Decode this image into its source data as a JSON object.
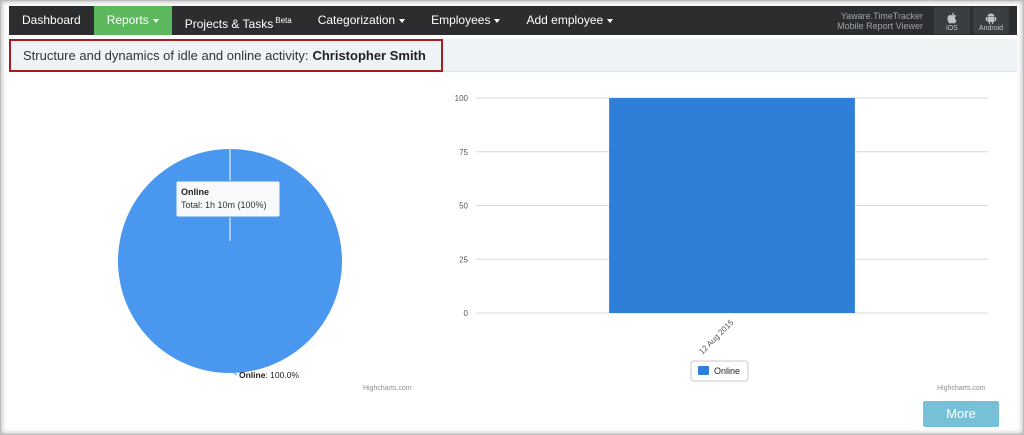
{
  "nav": {
    "items": [
      {
        "label": "Dashboard",
        "active": false,
        "dropdown": false
      },
      {
        "label": "Reports",
        "active": true,
        "dropdown": true
      },
      {
        "label": "Projects & Tasks",
        "badge": "Beta",
        "active": false,
        "dropdown": false
      },
      {
        "label": "Categorization",
        "active": false,
        "dropdown": true
      },
      {
        "label": "Employees",
        "active": false,
        "dropdown": true
      },
      {
        "label": "Add employee",
        "active": false,
        "dropdown": true
      }
    ],
    "mobile_line1": "Yaware.TimeTracker",
    "mobile_line2": "Mobile Report Viewer",
    "ios_label": "iOS",
    "android_label": "Android"
  },
  "header": {
    "title_prefix": "Structure and dynamics of idle and online activity:",
    "user_name": "Christopher Smith"
  },
  "pie": {
    "tooltip_title": "Online",
    "tooltip_text": "Total: 1h 10m (100%)",
    "label_name": "Online",
    "label_value": ": 100.0%",
    "credit": "Highcharts.com",
    "color": "#4a97ef"
  },
  "chart_data": [
    {
      "type": "pie",
      "slices": [
        {
          "name": "Online",
          "value": 100.0
        }
      ]
    },
    {
      "type": "bar",
      "categories": [
        "12 Aug 2015"
      ],
      "series": [
        {
          "name": "Online",
          "values": [
            100
          ]
        }
      ],
      "ylim": [
        0,
        100
      ],
      "yticks": [
        0,
        25,
        50,
        75,
        100
      ],
      "grid": true,
      "legend": "bottom-center",
      "color": "#2f7ed8"
    }
  ],
  "bar": {
    "credit": "Highcharts.com",
    "legend_label": "Online"
  },
  "actions": {
    "more_label": "More"
  }
}
